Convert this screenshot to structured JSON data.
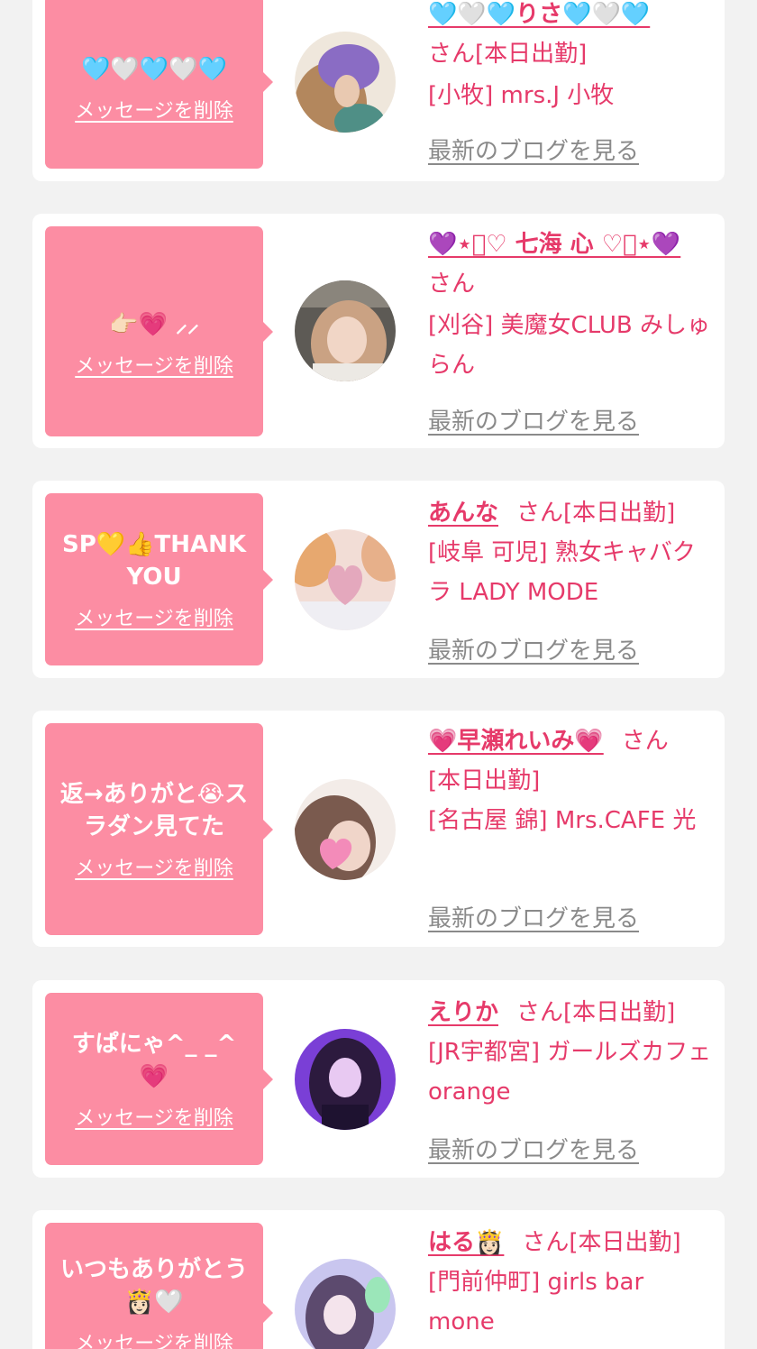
{
  "labels": {
    "delete_message": "メッセージを削除",
    "latest_blog": "最新のブログを見る"
  },
  "messages": [
    {
      "message_text": "🩵🤍🩵🤍🩵",
      "girl_name": "🩵🤍🩵りさ🩵🤍🩵",
      "honorific": "さん",
      "attendance": "[本日出勤]",
      "shop": "[小牧] mrs.J 小牧",
      "avatar_icon": "girl-photo-avatar",
      "avatar_color": "#c9a27c"
    },
    {
      "message_text": "👉🏻💗 ⸝⸝",
      "girl_name": "💜⋆͛♡ 七海 心 ♡͛⋆💜",
      "honorific": "さん",
      "attendance": "",
      "shop": "[刈谷] 美魔女CLUB みしゅらん",
      "avatar_icon": "girl-photo-avatar",
      "avatar_color": "#b8a48e"
    },
    {
      "message_text": "SP💛👍THANK YOU",
      "girl_name": "あんな",
      "honorific": "さん",
      "attendance": "[本日出勤]",
      "shop": "[岐阜 可児] 熟女キャバクラ LADY MODE",
      "avatar_icon": "heart-photo-avatar",
      "avatar_color": "#e7b8b4"
    },
    {
      "message_text": "返→ありがと😭スラダン見てた",
      "girl_name": "💗早瀬れいみ💗",
      "honorific": "さん",
      "attendance": "[本日出勤]",
      "shop": "[名古屋 錦] Mrs.CAFE 光",
      "avatar_icon": "girl-photo-avatar",
      "avatar_color": "#8a6d62"
    },
    {
      "message_text": "すぱにゃ^_ _^ 💗",
      "girl_name": "えりか",
      "honorific": "さん",
      "attendance": "[本日出勤]",
      "shop": "[JR宇都宮] ガールズカフェ orange",
      "avatar_icon": "girl-photo-avatar",
      "avatar_color": "#9b6ae6"
    },
    {
      "message_text": "いつもありがとう👸🏻🤍",
      "girl_name": "はる👸🏻",
      "honorific": "さん",
      "attendance": "[本日出勤]",
      "shop": "[門前仲町] girls bar mone",
      "avatar_icon": "girl-photo-avatar",
      "avatar_color": "#b9b3e6"
    }
  ]
}
